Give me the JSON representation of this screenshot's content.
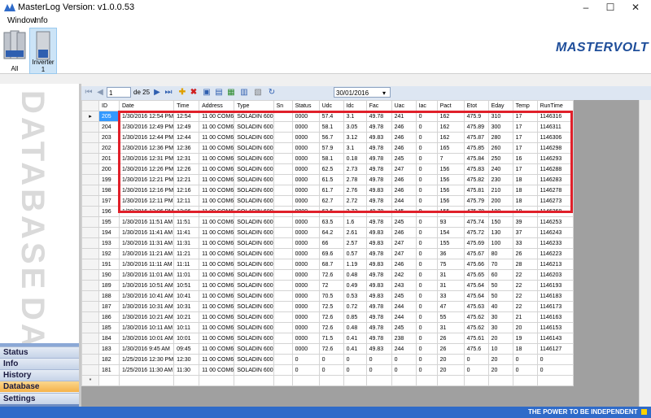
{
  "window": {
    "title": "MasterLog Version: v1.0.0.53",
    "minimize": "–",
    "maximize": "☐",
    "close": "✕"
  },
  "menu": [
    "Window",
    "Info"
  ],
  "devices": [
    {
      "label": "All",
      "icon": "inverter-group-icon"
    },
    {
      "label": "Inverter 1",
      "icon": "inverter-icon"
    }
  ],
  "brand": {
    "logo": "MASTERVOLT",
    "slogan": "THE POWER TO BE INDEPENDENT",
    "accent": "#2f6bc9",
    "highlight": "#e0202a"
  },
  "left_panel": {
    "watermark_1": "DATABASE",
    "watermark_2": "DAT"
  },
  "nav": [
    {
      "label": "Status",
      "active": false
    },
    {
      "label": "Info",
      "active": false
    },
    {
      "label": "History",
      "active": false
    },
    {
      "label": "Database",
      "active": true
    },
    {
      "label": "Settings",
      "active": false
    }
  ],
  "toolbar": {
    "page": "1",
    "page_of": "de 25",
    "date": "30/01/2016"
  },
  "table": {
    "columns": [
      "ID",
      "Date",
      "Time",
      "Address",
      "Type",
      "Sn",
      "Status",
      "Udc",
      "Idc",
      "Fac",
      "Uac",
      "Iac",
      "Pact",
      "Etot",
      "Eday",
      "Temp",
      "RunTime"
    ],
    "rows": [
      [
        "205",
        "1/30/2016 12:54 PM",
        "12:54",
        "11 00 COM6",
        "SOLADIN 600",
        "",
        "0000",
        "57.4",
        "3.1",
        "49.78",
        "241",
        "0",
        "162",
        "475.9",
        "310",
        "17",
        "1146316"
      ],
      [
        "204",
        "1/30/2016 12:49 PM",
        "12:49",
        "11 00 COM6",
        "SOLADIN 600",
        "",
        "0000",
        "58.1",
        "3.05",
        "49.78",
        "246",
        "0",
        "162",
        "475.89",
        "300",
        "17",
        "1146311"
      ],
      [
        "203",
        "1/30/2016 12:44 PM",
        "12:44",
        "11 00 COM6",
        "SOLADIN 600",
        "",
        "0000",
        "56.7",
        "3.12",
        "49.83",
        "246",
        "0",
        "162",
        "475.87",
        "280",
        "17",
        "1146306"
      ],
      [
        "202",
        "1/30/2016 12:36 PM",
        "12:36",
        "11 00 COM6",
        "SOLADIN 600",
        "",
        "0000",
        "57.9",
        "3.1",
        "49.78",
        "246",
        "0",
        "165",
        "475.85",
        "260",
        "17",
        "1146298"
      ],
      [
        "201",
        "1/30/2016 12:31 PM",
        "12:31",
        "11 00 COM6",
        "SOLADIN 600",
        "",
        "0000",
        "58.1",
        "0.18",
        "49.78",
        "245",
        "0",
        "7",
        "475.84",
        "250",
        "16",
        "1146293"
      ],
      [
        "200",
        "1/30/2016 12:26 PM",
        "12:26",
        "11 00 COM6",
        "SOLADIN 600",
        "",
        "0000",
        "62.5",
        "2.73",
        "49.78",
        "247",
        "0",
        "156",
        "475.83",
        "240",
        "17",
        "1146288"
      ],
      [
        "199",
        "1/30/2016 12:21 PM",
        "12:21",
        "11 00 COM6",
        "SOLADIN 600",
        "",
        "0000",
        "61.5",
        "2.78",
        "49.78",
        "246",
        "0",
        "156",
        "475.82",
        "230",
        "18",
        "1146283"
      ],
      [
        "198",
        "1/30/2016 12:16 PM",
        "12:16",
        "11 00 COM6",
        "SOLADIN 600",
        "",
        "0000",
        "61.7",
        "2.76",
        "49.83",
        "246",
        "0",
        "156",
        "475.81",
        "210",
        "18",
        "1146278"
      ],
      [
        "197",
        "1/30/2016 12:11 PM",
        "12:11",
        "11 00 COM6",
        "SOLADIN 600",
        "",
        "0000",
        "62.7",
        "2.72",
        "49.78",
        "244",
        "0",
        "156",
        "475.79",
        "200",
        "18",
        "1146273"
      ],
      [
        "196",
        "1/30/2016 12:06 PM",
        "12:06",
        "11 00 COM6",
        "SOLADIN 600",
        "",
        "0000",
        "62.5",
        "2.72",
        "49.78",
        "245",
        "0",
        "155",
        "475.78",
        "190",
        "18",
        "1146268"
      ],
      [
        "195",
        "1/30/2016 11:51 AM",
        "11:51",
        "11 00 COM6",
        "SOLADIN 600",
        "",
        "0000",
        "63.5",
        "1.6",
        "49.78",
        "245",
        "0",
        "93",
        "475.74",
        "150",
        "39",
        "1146253"
      ],
      [
        "194",
        "1/30/2016 11:41 AM",
        "11:41",
        "11 00 COM6",
        "SOLADIN 600",
        "",
        "0000",
        "64.2",
        "2.61",
        "49.83",
        "246",
        "0",
        "154",
        "475.72",
        "130",
        "37",
        "1146243"
      ],
      [
        "193",
        "1/30/2016 11:31 AM",
        "11:31",
        "11 00 COM6",
        "SOLADIN 600",
        "",
        "0000",
        "66",
        "2.57",
        "49.83",
        "247",
        "0",
        "155",
        "475.69",
        "100",
        "33",
        "1146233"
      ],
      [
        "192",
        "1/30/2016 11:21 AM",
        "11:21",
        "11 00 COM6",
        "SOLADIN 600",
        "",
        "0000",
        "69.6",
        "0.57",
        "49.78",
        "247",
        "0",
        "36",
        "475.67",
        "80",
        "26",
        "1146223"
      ],
      [
        "191",
        "1/30/2016 11:11 AM",
        "11:11",
        "11 00 COM6",
        "SOLADIN 600",
        "",
        "0000",
        "68.7",
        "1.19",
        "49.83",
        "246",
        "0",
        "75",
        "475.66",
        "70",
        "28",
        "1146213"
      ],
      [
        "190",
        "1/30/2016 11:01 AM",
        "11:01",
        "11 00 COM6",
        "SOLADIN 600",
        "",
        "0000",
        "72.6",
        "0.48",
        "49.78",
        "242",
        "0",
        "31",
        "475.65",
        "60",
        "22",
        "1146203"
      ],
      [
        "189",
        "1/30/2016 10:51 AM",
        "10:51",
        "11 00 COM6",
        "SOLADIN 600",
        "",
        "0000",
        "72",
        "0.49",
        "49.83",
        "243",
        "0",
        "31",
        "475.64",
        "50",
        "22",
        "1146193"
      ],
      [
        "188",
        "1/30/2016 10:41 AM",
        "10:41",
        "11 00 COM6",
        "SOLADIN 600",
        "",
        "0000",
        "70.5",
        "0.53",
        "49.83",
        "245",
        "0",
        "33",
        "475.64",
        "50",
        "22",
        "1146183"
      ],
      [
        "187",
        "1/30/2016 10:31 AM",
        "10:31",
        "11 00 COM6",
        "SOLADIN 600",
        "",
        "0000",
        "72.5",
        "0.72",
        "49.78",
        "244",
        "0",
        "47",
        "475.63",
        "40",
        "22",
        "1146173"
      ],
      [
        "186",
        "1/30/2016 10:21 AM",
        "10:21",
        "11 00 COM6",
        "SOLADIN 600",
        "",
        "0000",
        "72.6",
        "0.85",
        "49.78",
        "244",
        "0",
        "55",
        "475.62",
        "30",
        "21",
        "1146163"
      ],
      [
        "185",
        "1/30/2016 10:11 AM",
        "10:11",
        "11 00 COM6",
        "SOLADIN 600",
        "",
        "0000",
        "72.6",
        "0.48",
        "49.78",
        "245",
        "0",
        "31",
        "475.62",
        "30",
        "20",
        "1146153"
      ],
      [
        "184",
        "1/30/2016 10:01 AM",
        "10:01",
        "11 00 COM6",
        "SOLADIN 600",
        "",
        "0000",
        "71.5",
        "0.41",
        "49.78",
        "238",
        "0",
        "26",
        "475.61",
        "20",
        "19",
        "1146143"
      ],
      [
        "183",
        "1/30/2016 9:45 AM",
        "09:45",
        "11 00 COM6",
        "SOLADIN 600",
        "",
        "0000",
        "72.6",
        "0.41",
        "49.83",
        "244",
        "0",
        "26",
        "475.6",
        "10",
        "18",
        "1146127"
      ],
      [
        "182",
        "1/25/2016 12:30 PM",
        "12:30",
        "11 00 COM6",
        "SOLADIN 600",
        "",
        "0",
        "0",
        "0",
        "0",
        "0",
        "0",
        "20",
        "0",
        "20",
        "0",
        "0"
      ],
      [
        "181",
        "1/25/2016 11:30 AM",
        "11:30",
        "11 00 COM6",
        "SOLADIN 600",
        "",
        "0",
        "0",
        "0",
        "0",
        "0",
        "0",
        "20",
        "0",
        "20",
        "0",
        "0"
      ]
    ]
  }
}
